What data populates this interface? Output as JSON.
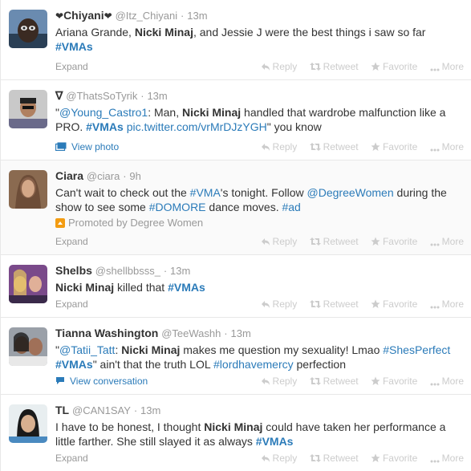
{
  "actions": {
    "reply": "Reply",
    "retweet": "Retweet",
    "favorite": "Favorite",
    "more": "More"
  },
  "colors": {
    "link": "#2b7bb9",
    "muted": "#999999",
    "action": "#cccccc"
  },
  "tweets": [
    {
      "heart_left": "❤",
      "name": "Chiyani",
      "heart_right": "❤",
      "username": "@Itz_Chiyani",
      "time": "13m",
      "parts": [
        "Ariana Grande, ",
        "Nicki Minaj",
        ", and Jessie J were the best things i saw so far ",
        "#VMAs"
      ],
      "expand": "Expand"
    },
    {
      "name_prefix": "∇",
      "username": "@ThatsSoTyrik",
      "time": "13m",
      "parts": [
        "\"",
        "@Young_Castro1",
        ": Man, ",
        "Nicki Minaj",
        " handled that wardrobe malfunction like a PRO. ",
        "#VMAs",
        " ",
        "pic.twitter.com/vrMrDJzYGH",
        "\" you know"
      ],
      "expand": "View photo",
      "expand_icon": "photo-icon"
    },
    {
      "name": "Ciara",
      "username": "@ciara",
      "time": "9h",
      "parts": [
        "Can't wait to check out the ",
        "#VMA",
        "'s tonight. Follow ",
        "@DegreeWomen",
        " during the show to see some ",
        "#DOMORE",
        " dance moves. ",
        "#ad"
      ],
      "promoted": "Promoted by Degree Women",
      "expand": "Expand"
    },
    {
      "name": "Shelbs",
      "username": "@shellbbsss_",
      "time": "13m",
      "parts": [
        "Nicki Minaj",
        " killed that ",
        "#VMAs"
      ],
      "expand": "Expand"
    },
    {
      "name": "Tianna Washington",
      "username": "@TeeWashh",
      "time": "13m",
      "parts": [
        "\"",
        "@Tatii_Tatt",
        ": ",
        "Nicki Minaj",
        " makes me question my sexuality!  Lmao ",
        "#ShesPerfect",
        " ",
        "#VMAs",
        "\" ain't that the truth LOL ",
        "#lordhavemercy",
        " perfection"
      ],
      "expand": "View conversation",
      "expand_icon": "conversation-icon"
    },
    {
      "name": "TL",
      "username": "@CAN1SAY",
      "time": "13m",
      "parts": [
        "I have to be honest, I thought ",
        "Nicki Minaj",
        " could have taken her performance a little farther. She still slayed it as always ",
        "#VMAs"
      ],
      "expand": "Expand"
    }
  ],
  "dot": "·"
}
